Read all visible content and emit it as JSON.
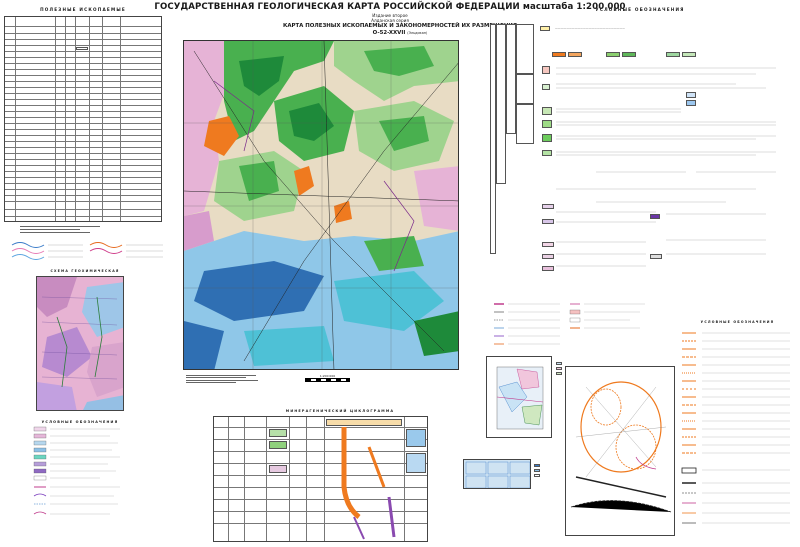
{
  "title": "ГОСУДАРСТВЕННАЯ ГЕОЛОГИЧЕСКАЯ КАРТА РОССИЙСКОЙ ФЕДЕРАЦИИ масштаба 1:200 000",
  "edition": "Издание второе",
  "series": "Алданская серия",
  "map_title": "КАРТА ПОЛЕЗНЫХ ИСКОПАЕМЫХ И ЗАКОНОМЕРНОСТЕЙ ИХ РАЗМЕЩЕНИЯ",
  "sheet": "O-52-XXVII",
  "sheet_suffix": "(Эльдикан)",
  "left_panel": {
    "title": "ПОЛЕЗНЫЕ ИСКОПАЕМЫЕ"
  },
  "right_panel": {
    "title": "УСЛОВНЫЕ ОБОЗНАЧЕНИЯ"
  },
  "inset_geo": {
    "title": "СХЕМА ГЕОХИМИЧЕСКАЯ"
  },
  "inset_small_legend": {
    "title": "УСЛОВНЫЕ ОБОЗНАЧЕНИЯ"
  },
  "bottom_center": {
    "title": "МИНЕРАГЕНИЧЕСКИЙ ЦИКЛОГРАММА"
  },
  "right_lower": {
    "title": "УСЛОВНЫЕ ОБОЗНАЧЕНИЯ"
  },
  "scale_text": "1:200 000",
  "colors": {
    "green_dark": "#1e8a3a",
    "green_mid": "#49b04f",
    "green_light": "#9fd38e",
    "blue_dark": "#2f6fb3",
    "blue_light": "#8fc7e8",
    "cyan": "#4ec1d6",
    "pink": "#e6b3d6",
    "beige": "#e8dcc4",
    "orange": "#ef7a1f",
    "purple": "#8a4ab0"
  }
}
